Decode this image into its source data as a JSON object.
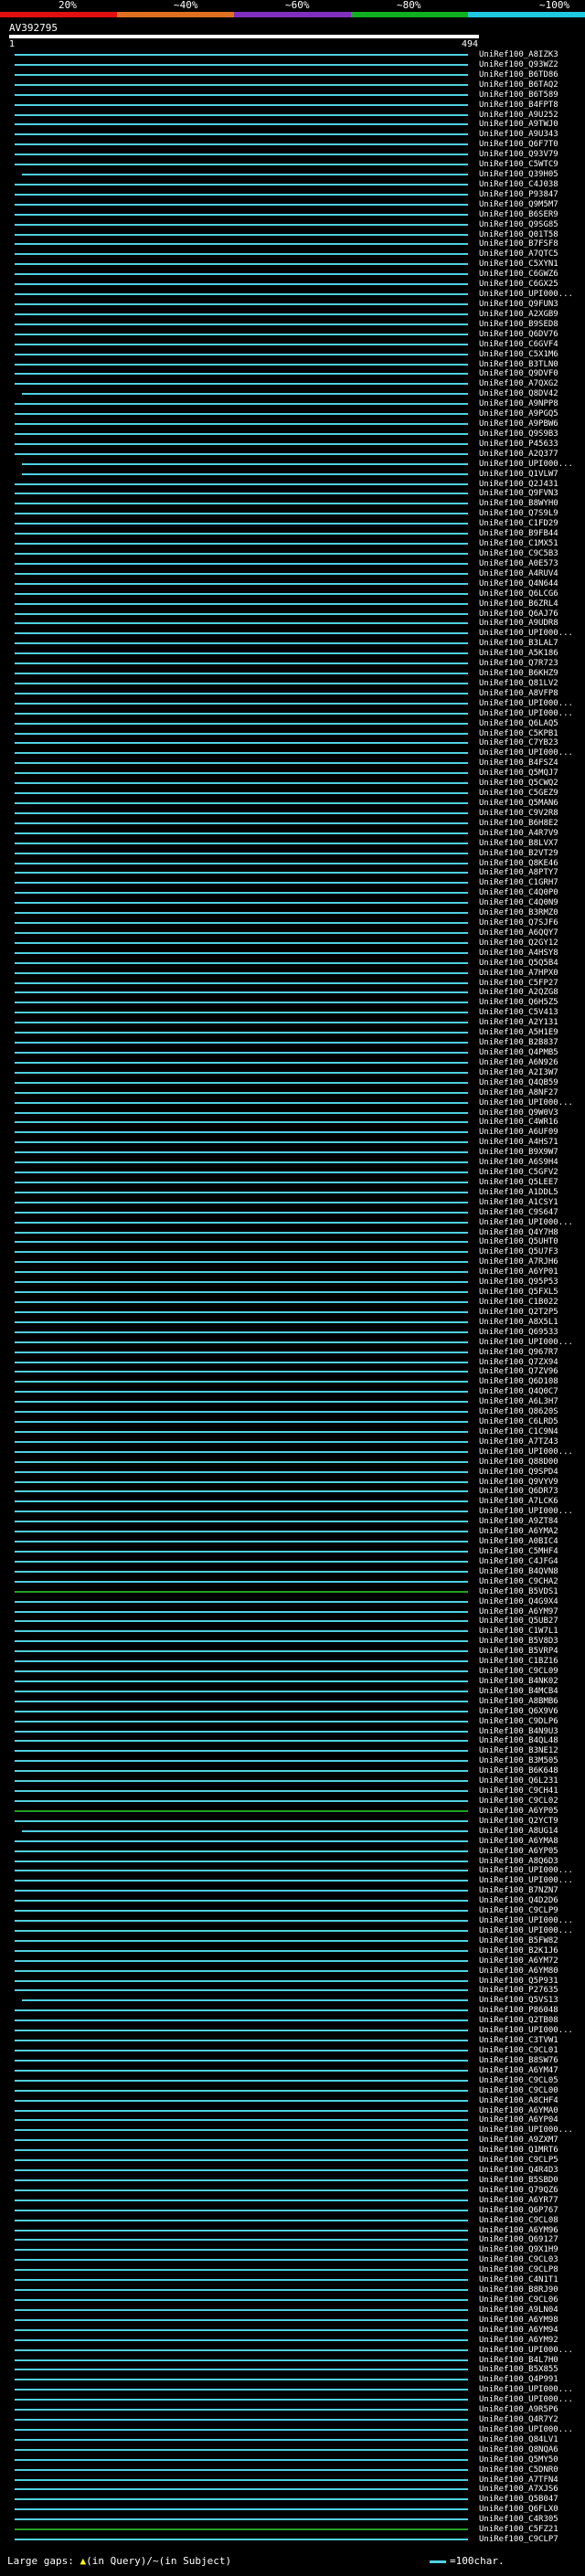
{
  "scale": {
    "labels": [
      "20%",
      "~40%",
      "~60%",
      "~80%",
      "~100%"
    ],
    "colors": [
      "#e01010",
      "#e07020",
      "#8030c0",
      "#10b020",
      "#20c8e0"
    ]
  },
  "query": {
    "name": "AV392795",
    "start": "1",
    "end": "494"
  },
  "colors": {
    "cyan": "#4fd0e0",
    "green": "#22a022",
    "query": "#ffffff"
  },
  "hits": [
    "UniRef100_A8IZK3",
    "UniRef100_Q93WZ2",
    "UniRef100_B6TD86",
    "UniRef100_B6TAQ2",
    "UniRef100_B6T589",
    "UniRef100_B4FPT8",
    "UniRef100_A9U252",
    "UniRef100_A9TWJ0",
    "UniRef100_A9U343",
    "UniRef100_Q6F7T0",
    "UniRef100_Q93V79",
    "UniRef100_C5WTC9",
    "UniRef100_Q39H05",
    "UniRef100_C4J038",
    "UniRef100_P93847",
    "UniRef100_Q9M5M7",
    "UniRef100_B6SER9",
    "UniRef100_Q9SG85",
    "UniRef100_Q01T58",
    "UniRef100_B7FSF8",
    "UniRef100_A7QTC5",
    "UniRef100_C5XYN1",
    "UniRef100_C6GWZ6",
    "UniRef100_C6GX25",
    "UniRef100_UPI000...",
    "UniRef100_Q9FUN3",
    "UniRef100_A2XGB9",
    "UniRef100_B9SED8",
    "UniRef100_Q6DV76",
    "UniRef100_C6GVF4",
    "UniRef100_C5X1M6",
    "UniRef100_B3TLN0",
    "UniRef100_Q9DVF0",
    "UniRef100_A7QXG2",
    "UniRef100_Q8DV42",
    "UniRef100_A9NPP8",
    "UniRef100_A9PGQ5",
    "UniRef100_A9PBW6",
    "UniRef100_Q9S9B3",
    "UniRef100_P45633",
    "UniRef100_A2Q377",
    "UniRef100_UPI000...",
    "UniRef100_Q1VLW7",
    "UniRef100_Q2J431",
    "UniRef100_Q9FVN3",
    "UniRef100_B8WYH0",
    "UniRef100_Q7S9L9",
    "UniRef100_C1FD29",
    "UniRef100_B9FB44",
    "UniRef100_C1MX51",
    "UniRef100_C9C5B3",
    "UniRef100_A0E573",
    "UniRef100_A4RUV4",
    "UniRef100_Q4N644",
    "UniRef100_Q6LCG6",
    "UniRef100_B6ZRL4",
    "UniRef100_Q6AJ76",
    "UniRef100_A9UDR8",
    "UniRef100_UPI000...",
    "UniRef100_B3LAL7",
    "UniRef100_A5K186",
    "UniRef100_Q7R723",
    "UniRef100_B6KHZ9",
    "UniRef100_Q81LV2",
    "UniRef100_A8VFP8",
    "UniRef100_UPI000...",
    "UniRef100_UPI000...",
    "UniRef100_Q6LAQ5",
    "UniRef100_C5KPB1",
    "UniRef100_C7YB23",
    "UniRef100_UPI000...",
    "UniRef100_B4FSZ4",
    "UniRef100_Q5MQJ7",
    "UniRef100_Q5CWQ2",
    "UniRef100_C5GEZ9",
    "UniRef100_Q5MAN6",
    "UniRef100_C9V2R8",
    "UniRef100_B6H8E2",
    "UniRef100_A4R7V9",
    "UniRef100_B8LVX7",
    "UniRef100_B2VT29",
    "UniRef100_Q8KE46",
    "UniRef100_A8PTY7",
    "UniRef100_C1GRH7",
    "UniRef100_C4Q0P0",
    "UniRef100_C4Q0N9",
    "UniRef100_B3RMZ0",
    "UniRef100_Q7SJF6",
    "UniRef100_A6QQY7",
    "UniRef100_Q2GY12",
    "UniRef100_A4HSY8",
    "UniRef100_Q5Q5B4",
    "UniRef100_A7HPX0",
    "UniRef100_C5FP27",
    "UniRef100_A2QZG8",
    "UniRef100_Q6H5Z5",
    "UniRef100_C5V413",
    "UniRef100_A2Y131",
    "UniRef100_A5H1E9",
    "UniRef100_B2B837",
    "UniRef100_Q4PMB5",
    "UniRef100_A6N926",
    "UniRef100_A2I3W7",
    "UniRef100_Q4QB59",
    "UniRef100_A8NF27",
    "UniRef100_UPI000...",
    "UniRef100_Q9W0V3",
    "UniRef100_C4WR16",
    "UniRef100_A6UF09",
    "UniRef100_A4HS71",
    "UniRef100_B9X9W7",
    "UniRef100_A6S9H4",
    "UniRef100_C5GFV2",
    "UniRef100_Q5LEE7",
    "UniRef100_A1DDL5",
    "UniRef100_A1CSY1",
    "UniRef100_C9S647",
    "UniRef100_UPI000...",
    "UniRef100_Q4Y7H8",
    "UniRef100_Q5UHT0",
    "UniRef100_Q5U7F3",
    "UniRef100_A7RJH6",
    "UniRef100_A6YP01",
    "UniRef100_Q95P53",
    "UniRef100_Q5FXL5",
    "UniRef100_C1B022",
    "UniRef100_Q2T2P5",
    "UniRef100_A8X5L1",
    "UniRef100_Q69533",
    "UniRef100_UPI000...",
    "UniRef100_Q967R7",
    "UniRef100_Q7ZX94",
    "UniRef100_Q7ZV96",
    "UniRef100_Q6D108",
    "UniRef100_Q4Q0C7",
    "UniRef100_A6L3H7",
    "UniRef100_Q8620S",
    "UniRef100_C6LRD5",
    "UniRef100_C1C9N4",
    "UniRef100_A7TZ43",
    "UniRef100_UPI000...",
    "UniRef100_Q88D00",
    "UniRef100_Q9SPD4",
    "UniRef100_Q9VYV9",
    "UniRef100_Q6DR73",
    "UniRef100_A7LCK6",
    "UniRef100_UPI000...",
    "UniRef100_A9ZT84",
    "UniRef100_A6YMA2",
    "UniRef100_A0BIC4",
    "UniRef100_C5MHF4",
    "UniRef100_C4JFG4",
    "UniRef100_B4QVN8",
    "UniRef100_C9CHA2",
    "UniRef100_B5VDS1",
    "UniRef100_Q4G9X4",
    "UniRef100_A6YM97",
    "UniRef100_Q5UB27",
    "UniRef100_C1W7L1",
    "UniRef100_B5V8D3",
    "UniRef100_B5VRP4",
    "UniRef100_C1BZ16",
    "UniRef100_C9CL09",
    "UniRef100_B4NK02",
    "UniRef100_B4MCB4",
    "UniRef100_A8BMB6",
    "UniRef100_Q6X9V6",
    "UniRef100_C9DLP6",
    "UniRef100_B4N9U3",
    "UniRef100_B4QL48",
    "UniRef100_B3NE12",
    "UniRef100_B3M505",
    "UniRef100_B6K648",
    "UniRef100_Q6L231",
    "UniRef100_C9CH41",
    "UniRef100_C9CL02",
    "UniRef100_A6YP05",
    "UniRef100_Q2YCT9",
    "UniRef100_A8UG14",
    "UniRef100_A6YMA8",
    "UniRef100_A6YP05",
    "UniRef100_A8Q6D3",
    "UniRef100_UPI000...",
    "UniRef100_UPI000...",
    "UniRef100_B7NZN7",
    "UniRef100_Q4D2D6",
    "UniRef100_C9CLP9",
    "UniRef100_UPI000...",
    "UniRef100_UPI000...",
    "UniRef100_B5FW82",
    "UniRef100_B2K1J6",
    "UniRef100_A6YM72",
    "UniRef100_A6YM80",
    "UniRef100_Q5P931",
    "UniRef100_P27635",
    "UniRef100_Q5VS13",
    "UniRef100_P86048",
    "UniRef100_Q2TB08",
    "UniRef100_UPI000...",
    "UniRef100_C3TVW1",
    "UniRef100_C9CL01",
    "UniRef100_B8SW76",
    "UniRef100_A6YM47",
    "UniRef100_C9CL05",
    "UniRef100_C9CL00",
    "UniRef100_A8CHF4",
    "UniRef100_A6YMA0",
    "UniRef100_A6YP04",
    "UniRef100_UPI000...",
    "UniRef100_A9ZXM7",
    "UniRef100_Q1MRT6",
    "UniRef100_C9CLP5",
    "UniRef100_Q4R4D3",
    "UniRef100_B5SBD0",
    "UniRef100_Q79QZ6",
    "UniRef100_A6YR77",
    "UniRef100_Q6P767",
    "UniRef100_C9CL08",
    "UniRef100_A6YM96",
    "UniRef100_Q69127",
    "UniRef100_Q9X1H9",
    "UniRef100_C9CL03",
    "UniRef100_C9CLP8",
    "UniRef100_C4N1T1",
    "UniRef100_B8RJ90",
    "UniRef100_C9CL06",
    "UniRef100_A9LN04",
    "UniRef100_A6YM98",
    "UniRef100_A6YM94",
    "UniRef100_A6YM92",
    "UniRef100_UPI000...",
    "UniRef100_B4L7H0",
    "UniRef100_B5X855",
    "UniRef100_Q4P991",
    "UniRef100_UPI000...",
    "UniRef100_UPI000...",
    "UniRef100_A9R5P6",
    "UniRef100_Q4R7Y2",
    "UniRef100_UPI000...",
    "UniRef100_Q84LV1",
    "UniRef100_Q8NQA6",
    "UniRef100_Q5MY50",
    "UniRef100_C5DNR0",
    "UniRef100_A7TFN4",
    "UniRef100_A7XJS6",
    "UniRef100_Q5B047",
    "UniRef100_Q6FLX0",
    "UniRef100_C4R305",
    "UniRef100_C5FZ21",
    "UniRef100_C9CLP7"
  ],
  "green_rows": [
    154,
    176,
    248,
    272,
    316,
    321,
    330
  ],
  "short_rows": [
    12,
    34,
    41,
    42,
    195,
    178,
    260,
    300,
    303,
    327
  ],
  "legend": {
    "gaps_label": "Large gaps:",
    "gaps_query": "(in Query)/",
    "gaps_subject": "(in Subject)",
    "gap_symbol": "▲",
    "gap_symbol_alt": "~",
    "key_label": "=100char."
  }
}
